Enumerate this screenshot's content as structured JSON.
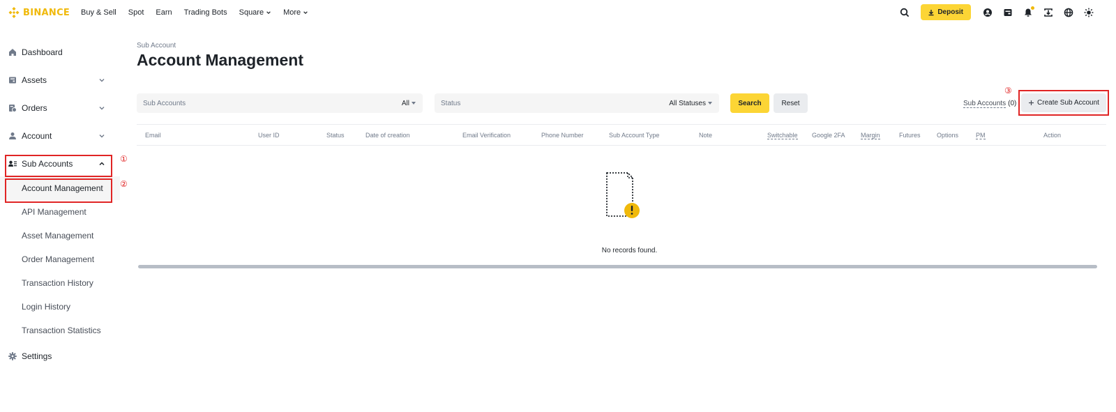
{
  "brand": {
    "name": "BINANCE",
    "accent": "#f0b90b",
    "button_yellow": "#fcd535",
    "annotation_red": "#e02424"
  },
  "nav": {
    "items": [
      {
        "label": "Buy & Sell",
        "dropdown": false
      },
      {
        "label": "Spot",
        "dropdown": false
      },
      {
        "label": "Earn",
        "dropdown": false
      },
      {
        "label": "Trading Bots",
        "dropdown": false
      },
      {
        "label": "Square",
        "dropdown": true
      },
      {
        "label": "More",
        "dropdown": true
      }
    ],
    "deposit_label": "Deposit",
    "tools": [
      "search-icon",
      "user-icon",
      "wallet-icon",
      "bell-icon",
      "download-icon",
      "globe-icon",
      "theme-icon"
    ]
  },
  "sidebar": {
    "items": [
      {
        "label": "Dashboard",
        "icon": "home-icon"
      },
      {
        "label": "Assets",
        "icon": "wallet-icon",
        "chevron": "down"
      },
      {
        "label": "Orders",
        "icon": "orders-icon",
        "chevron": "down"
      },
      {
        "label": "Account",
        "icon": "user-icon",
        "chevron": "down"
      },
      {
        "label": "Sub Accounts",
        "icon": "sub-accounts-icon",
        "chevron": "up"
      }
    ],
    "sub_items": [
      "Account Management",
      "API Management",
      "Asset Management",
      "Order Management",
      "Transaction History",
      "Login History",
      "Transaction Statistics"
    ],
    "settings_label": "Settings"
  },
  "annotations": {
    "m1": "①",
    "m2": "②",
    "m3": "③"
  },
  "main": {
    "breadcrumb": "Sub Account",
    "title": "Account Management",
    "filters": {
      "sub_accounts_placeholder": "Sub Accounts",
      "sub_accounts_value": "All",
      "status_placeholder": "Status",
      "status_value": "All Statuses"
    },
    "search_label": "Search",
    "reset_label": "Reset",
    "sub_accounts_link": "Sub Accounts",
    "sub_accounts_count": "(0)",
    "create_label": "Create Sub Account",
    "columns": [
      "Email",
      "User ID",
      "Status",
      "Date of creation",
      "Email Verification",
      "Phone Number",
      "Sub Account Type",
      "Note",
      "Switchable",
      "Google 2FA",
      "Margin",
      "Futures",
      "Options",
      "PM",
      "Action"
    ],
    "empty_text": "No records found."
  }
}
